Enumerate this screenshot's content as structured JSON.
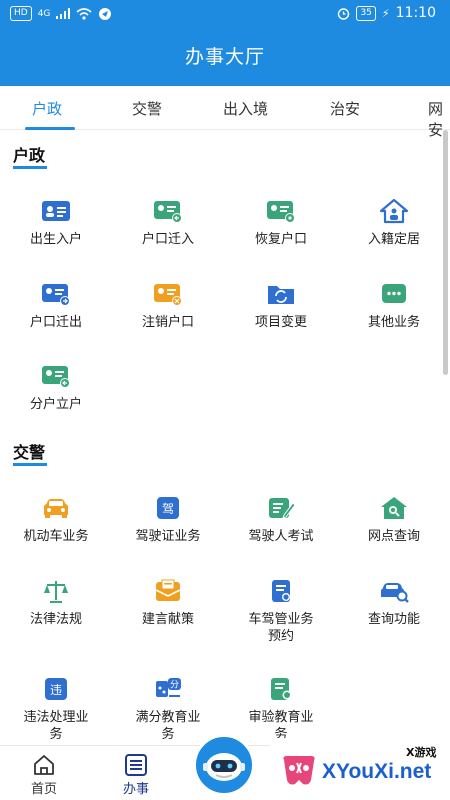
{
  "status_bar": {
    "network": "HD",
    "signal": "4G",
    "battery": "35",
    "time": "11:10"
  },
  "header": {
    "title": "办事大厅"
  },
  "tabs": [
    {
      "label": "户政",
      "active": true
    },
    {
      "label": "交警",
      "active": false
    },
    {
      "label": "出入境",
      "active": false
    },
    {
      "label": "治安",
      "active": false
    },
    {
      "label": "网安",
      "active": false
    }
  ],
  "sections": [
    {
      "title": "户政",
      "items": [
        {
          "label": "出生入户",
          "icon": "id-card-icon"
        },
        {
          "label": "户口迁入",
          "icon": "card-arrow-in-icon"
        },
        {
          "label": "恢复户口",
          "icon": "card-restore-icon"
        },
        {
          "label": "入籍定居",
          "icon": "house-person-icon"
        },
        {
          "label": "户口迁出",
          "icon": "card-arrow-out-icon"
        },
        {
          "label": "注销户口",
          "icon": "card-cancel-icon"
        },
        {
          "label": "项目变更",
          "icon": "folder-refresh-icon"
        },
        {
          "label": "其他业务",
          "icon": "chat-bubble-icon"
        },
        {
          "label": "分户立户",
          "icon": "card-split-icon"
        }
      ]
    },
    {
      "title": "交警",
      "items": [
        {
          "label": "机动车业务",
          "icon": "car-icon"
        },
        {
          "label": "驾驶证业务",
          "icon": "license-icon",
          "glyph": "驾"
        },
        {
          "label": "驾驶人考试",
          "icon": "exam-edit-icon"
        },
        {
          "label": "网点查询",
          "icon": "location-search-icon"
        },
        {
          "label": "法律法规",
          "icon": "scales-icon"
        },
        {
          "label": "建言献策",
          "icon": "envelope-icon"
        },
        {
          "label": "车驾管业务预约",
          "label_line1": "车驾管业务",
          "label_line2": "预约",
          "icon": "appointment-icon"
        },
        {
          "label": "查询功能",
          "icon": "car-search-icon"
        },
        {
          "label": "违法处理业务",
          "label_line1": "违法处理业",
          "label_line2": "务",
          "icon": "violation-icon",
          "glyph": "违"
        },
        {
          "label": "满分教育业务",
          "label_line1": "满分教育业",
          "label_line2": "务",
          "icon": "score-education-icon",
          "glyph": "分"
        },
        {
          "label": "审验教育业务",
          "label_line1": "审验教育业",
          "label_line2": "务",
          "icon": "review-education-icon"
        }
      ]
    }
  ],
  "bottom_nav": [
    {
      "label": "首页",
      "icon": "home-icon",
      "active": false
    },
    {
      "label": "办事",
      "icon": "list-icon",
      "active": true
    }
  ],
  "watermark": {
    "brand": "XYouXi.net",
    "small": "X游戏"
  },
  "colors": {
    "primary": "#1f8be0",
    "green": "#3aa57a",
    "orange": "#f0a020",
    "blue": "#2f6fd0"
  }
}
